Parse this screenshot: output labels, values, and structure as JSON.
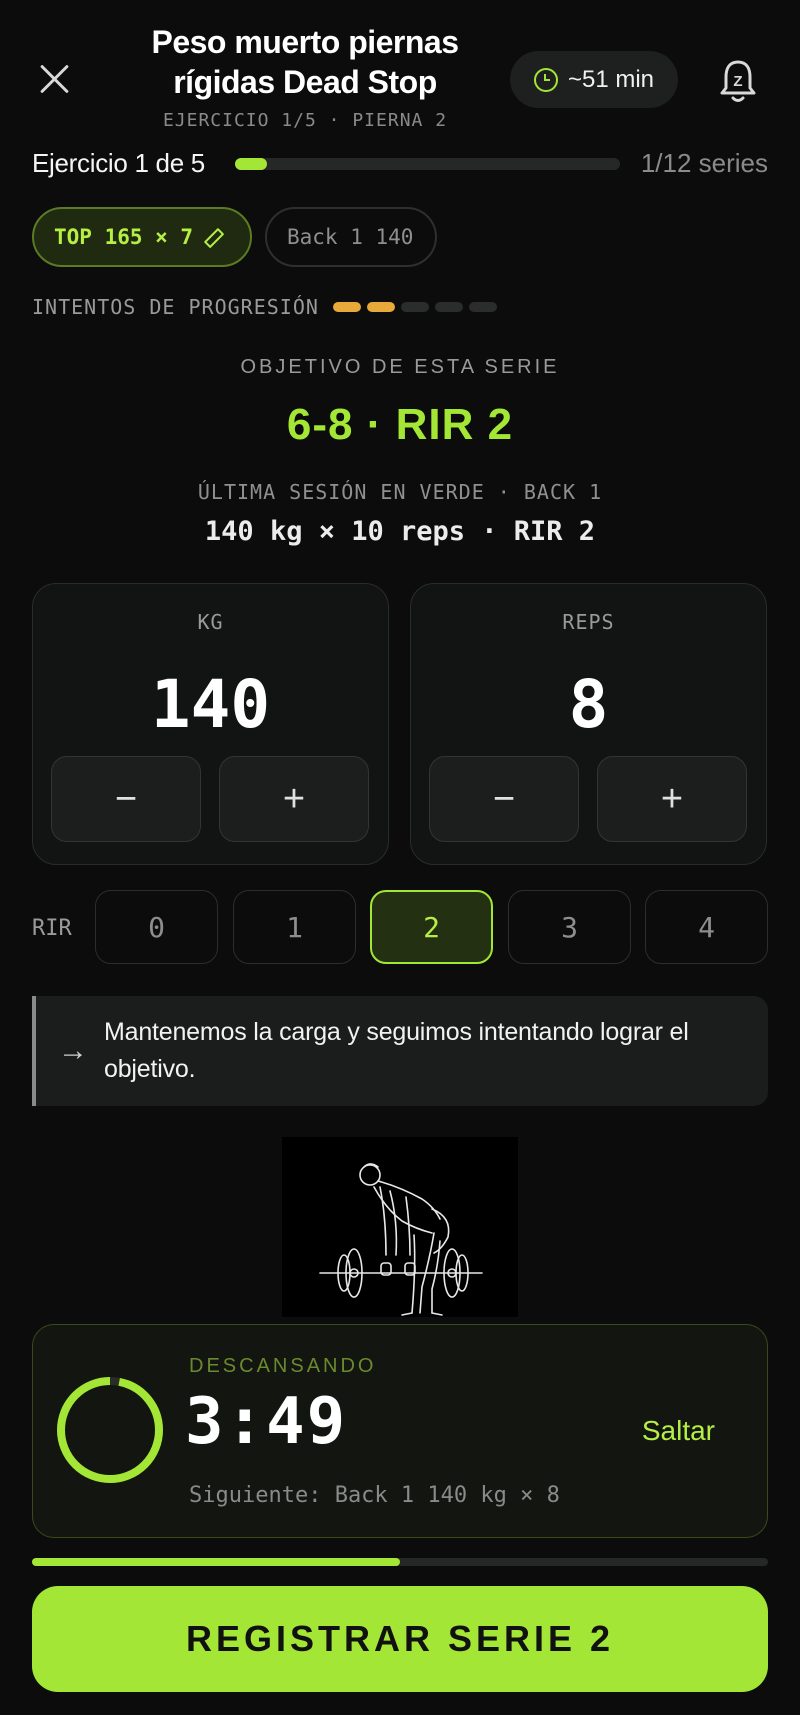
{
  "header": {
    "title": "Peso muerto piernas rígidas Dead Stop",
    "subtitle": "EJERCICIO 1/5 · PIERNA 2",
    "time": "~51 min",
    "notification_badge": "Z"
  },
  "progress": {
    "exercise_label": "Ejercicio 1 de 5",
    "series_label": "1/12 series",
    "fraction": 0.0833
  },
  "chips": {
    "top": "TOP 165 × 7",
    "back": "Back 1 140"
  },
  "progression": {
    "label": "INTENTOS DE PROGRESIÓN",
    "filled": 2,
    "total": 5,
    "color_on": "#e6a93a"
  },
  "objective": {
    "label": "OBJETIVO DE ESTA SERIE",
    "value": "6-8 · RIR 2",
    "last_label": "ÚLTIMA SESIÓN EN VERDE · BACK 1",
    "last_value": "140 kg × 10 reps · RIR 2"
  },
  "kg": {
    "label": "KG",
    "value": "140",
    "minus": "−",
    "plus": "+"
  },
  "reps": {
    "label": "REPS",
    "value": "8",
    "minus": "−",
    "plus": "+"
  },
  "rir": {
    "label": "RIR",
    "options": [
      "0",
      "1",
      "2",
      "3",
      "4"
    ],
    "selected": "2"
  },
  "note": {
    "arrow": "→",
    "text": "Mantenemos la carga y seguimos intentando lograr el objetivo."
  },
  "rest": {
    "label": "DESCANSANDO",
    "time": "3:49",
    "next": "Siguiente: Back 1 140 kg × 8",
    "skip": "Saltar",
    "ring_fraction": 0.97
  },
  "session_progress": 0.5,
  "cta": {
    "label": "REGISTRAR SERIE 2"
  },
  "colors": {
    "accent": "#a3e635",
    "background": "#0b0c0b"
  }
}
